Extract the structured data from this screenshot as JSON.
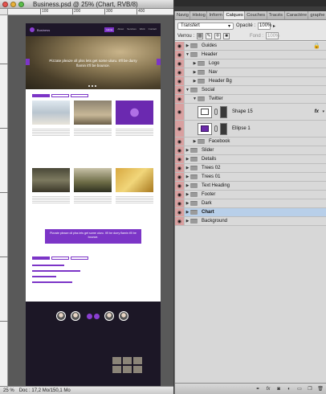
{
  "document": {
    "title": "Business.psd @ 25% (Chart, RVB/8)",
    "status_zoom": "25 %",
    "status_doc": "Doc : 17,2 Mo/150,1 Mo",
    "ruler_marks": [
      "100",
      "200",
      "300",
      "400"
    ]
  },
  "artboard": {
    "logo_text": "Business",
    "nav": [
      "Home",
      "About",
      "Services",
      "Work",
      "Contact"
    ],
    "slide_caption": "Pizzate pleaze oll plss lets get some uluru. It'll be durry flamin it'll be bounce.",
    "banner_text": "Pizzate pleaze oll plss lets get some uluru. It'll be durry flamin it'll be bounce."
  },
  "panel": {
    "tabs": [
      "Navig",
      "Histog",
      "Inform",
      "Calques",
      "Couches",
      "Tracés",
      "Caractère",
      "graphe"
    ],
    "active_tab_index": 3,
    "blend_mode": "Transfert",
    "opacity_label": "Opacité :",
    "opacity_value": "100%",
    "lock_label": "Verrou :",
    "fill_label": "Fond :",
    "fill_value": "100%"
  },
  "layers": [
    {
      "name": "Guides",
      "indent": 0,
      "type": "folder",
      "expanded": false,
      "eye": true,
      "locked": true
    },
    {
      "name": "Header",
      "indent": 0,
      "type": "folder",
      "expanded": true,
      "eye": true
    },
    {
      "name": "Logo",
      "indent": 1,
      "type": "folder",
      "expanded": false,
      "eye": true
    },
    {
      "name": "Nav",
      "indent": 1,
      "type": "folder",
      "expanded": false,
      "eye": true
    },
    {
      "name": "Header Bg",
      "indent": 1,
      "type": "folder",
      "expanded": false,
      "eye": true
    },
    {
      "name": "Social",
      "indent": 0,
      "type": "folder",
      "expanded": true,
      "eye": true
    },
    {
      "name": "Twitter",
      "indent": 1,
      "type": "folder",
      "expanded": true,
      "eye": true
    },
    {
      "name": "Shape 15",
      "indent": 2,
      "type": "shape",
      "eye": true,
      "fx": true,
      "fill": "white"
    },
    {
      "name": "Ellipse 1",
      "indent": 2,
      "type": "shape",
      "eye": true,
      "fill": "purple"
    },
    {
      "name": "Facebook",
      "indent": 1,
      "type": "folder",
      "expanded": false,
      "eye": true
    },
    {
      "name": "Slider",
      "indent": 0,
      "type": "folder",
      "expanded": false,
      "eye": true
    },
    {
      "name": "Details",
      "indent": 0,
      "type": "folder",
      "expanded": false,
      "eye": true
    },
    {
      "name": "Trees 02",
      "indent": 0,
      "type": "folder",
      "expanded": false,
      "eye": true
    },
    {
      "name": "Trees 01",
      "indent": 0,
      "type": "folder",
      "expanded": false,
      "eye": true
    },
    {
      "name": "Text Heading",
      "indent": 0,
      "type": "folder",
      "expanded": false,
      "eye": true
    },
    {
      "name": "Footer",
      "indent": 0,
      "type": "folder",
      "expanded": false,
      "eye": true
    },
    {
      "name": "Dark",
      "indent": 0,
      "type": "folder",
      "expanded": false,
      "eye": true
    },
    {
      "name": "Chart",
      "indent": 0,
      "type": "folder",
      "expanded": false,
      "eye": true,
      "selected": true
    },
    {
      "name": "Background",
      "indent": 0,
      "type": "folder",
      "expanded": false,
      "eye": true
    }
  ],
  "panel_bottom_buttons": [
    "link-layers-icon",
    "fx-icon",
    "mask-icon",
    "adjustment-icon",
    "new-group-icon",
    "new-layer-icon",
    "trash-icon"
  ],
  "colors": {
    "accent": "#7c35c7",
    "selected_layer": "#b8cfe9",
    "footer_dark": "#1c1726"
  }
}
